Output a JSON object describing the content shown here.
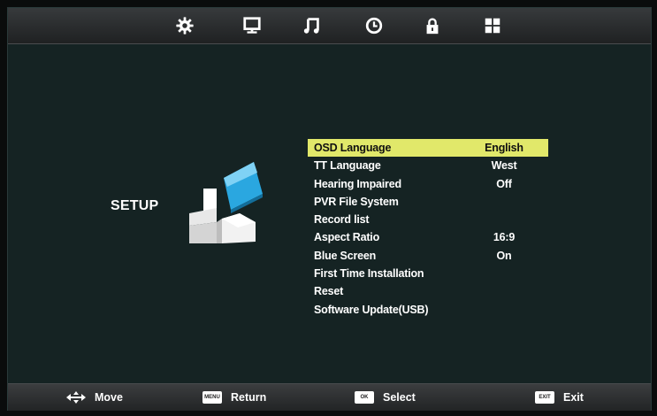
{
  "top_icons": [
    "gear-icon",
    "monitor-icon",
    "music-note-icon",
    "clock-icon",
    "lock-icon",
    "grid-icon"
  ],
  "setup": {
    "title": "SETUP"
  },
  "menu": {
    "items": [
      {
        "label": "OSD Language",
        "value": "English",
        "selected": true
      },
      {
        "label": "TT Language",
        "value": "West"
      },
      {
        "label": "Hearing Impaired",
        "value": "Off"
      },
      {
        "label": "PVR File System",
        "value": ""
      },
      {
        "label": "Record list",
        "value": ""
      },
      {
        "label": "Aspect Ratio",
        "value": "16:9"
      },
      {
        "label": "Blue Screen",
        "value": "On"
      },
      {
        "label": "First Time Installation",
        "value": ""
      },
      {
        "label": "Reset",
        "value": ""
      },
      {
        "label": "Software Update(USB)",
        "value": ""
      }
    ]
  },
  "footer": {
    "move": "Move",
    "return": "Return",
    "return_key": "MENU",
    "select": "Select",
    "select_key": "OK",
    "exit": "Exit",
    "exit_key": "EXIT"
  },
  "colors": {
    "highlight": "#e1e86a",
    "background": "#152323",
    "accent_blue": "#2aa7e0"
  }
}
